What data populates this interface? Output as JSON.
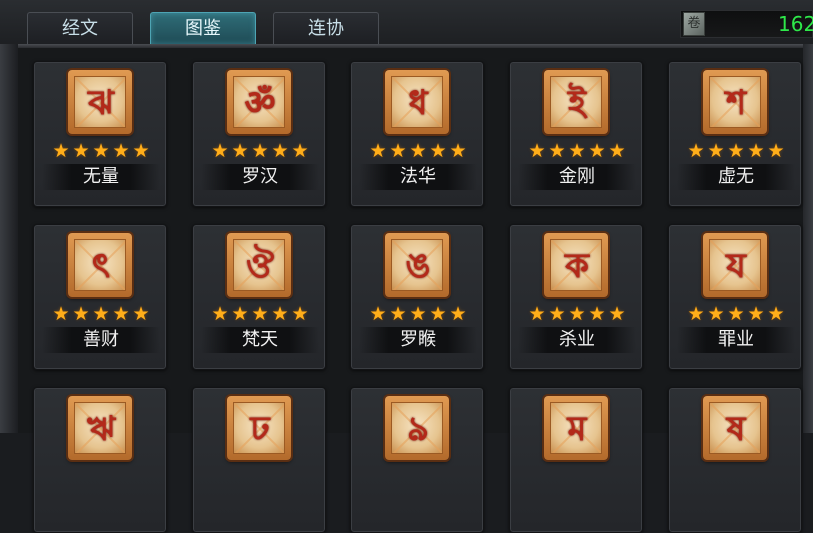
{
  "tabs": [
    {
      "label": "经文",
      "active": false
    },
    {
      "label": "图鉴",
      "active": true
    },
    {
      "label": "连协",
      "active": false
    }
  ],
  "currency": {
    "icon": "scroll-icon",
    "value": "162"
  },
  "star_icon": "★",
  "cards": [
    {
      "name": "无量",
      "glyph": "ঝ",
      "stars": 5
    },
    {
      "name": "罗汉",
      "glyph": "ॐ",
      "stars": 5
    },
    {
      "name": "法华",
      "glyph": "ধ",
      "stars": 5
    },
    {
      "name": "金刚",
      "glyph": "ই",
      "stars": 5
    },
    {
      "name": "虚无",
      "glyph": "শ",
      "stars": 5
    },
    {
      "name": "善财",
      "glyph": "ৎ",
      "stars": 5
    },
    {
      "name": "梵天",
      "glyph": "ঔ",
      "stars": 5
    },
    {
      "name": "罗睺",
      "glyph": "ঙ",
      "stars": 5
    },
    {
      "name": "杀业",
      "glyph": "ক",
      "stars": 5
    },
    {
      "name": "罪业",
      "glyph": "য",
      "stars": 5
    },
    {
      "name": "",
      "glyph": "ঋ",
      "stars": 0
    },
    {
      "name": "",
      "glyph": "ঢ",
      "stars": 0
    },
    {
      "name": "",
      "glyph": "ঌ",
      "stars": 0
    },
    {
      "name": "",
      "glyph": "ম",
      "stars": 0
    },
    {
      "name": "",
      "glyph": "ষ",
      "stars": 0
    }
  ]
}
